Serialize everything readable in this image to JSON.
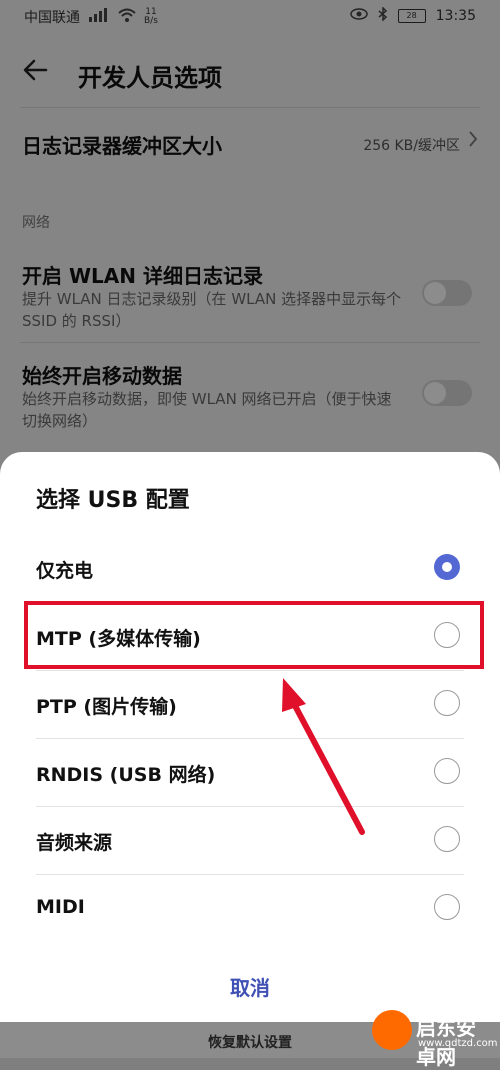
{
  "statusbar": {
    "carrier": "中国联通",
    "net_speed_top": "11",
    "net_speed_bottom": "B/s",
    "battery": "28",
    "time": "13:35"
  },
  "appbar": {
    "title": "开发人员选项"
  },
  "rows": {
    "log_buffer": {
      "title": "日志记录器缓冲区大小",
      "value": "256 KB/缓冲区"
    },
    "network_section": "网络",
    "wlan_log": {
      "title": "开启 WLAN 详细日志记录",
      "desc": "提升 WLAN 日志记录级别（在 WLAN 选择器中显示每个 SSID 的 RSSI）"
    },
    "mobile_data": {
      "title": "始终开启移动数据",
      "desc": "始终开启移动数据，即使 WLAN 网络已开启（便于快速切换网络）"
    }
  },
  "dialog": {
    "title": "选择 USB 配置",
    "options": [
      {
        "label": "仅充电",
        "selected": true
      },
      {
        "label": "MTP (多媒体传输)",
        "selected": false
      },
      {
        "label": "PTP (图片传输)",
        "selected": false
      },
      {
        "label": "RNDIS (USB 网络)",
        "selected": false
      },
      {
        "label": "音频来源",
        "selected": false
      },
      {
        "label": "MIDI",
        "selected": false
      }
    ],
    "cancel": "取消"
  },
  "bottom": {
    "reset": "恢复默认设置"
  },
  "watermark": {
    "main": "启东安卓网",
    "sub": "www.qdtzd.com"
  },
  "colors": {
    "accent": "#5468d4",
    "highlight": "#e0102a",
    "cancel": "#3f51b5"
  }
}
